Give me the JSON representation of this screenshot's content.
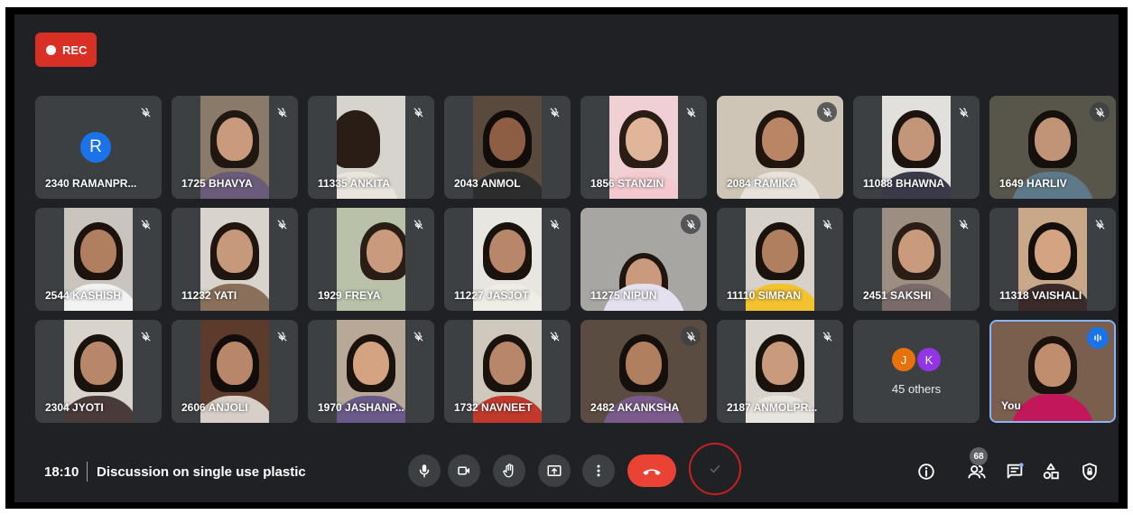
{
  "rec": {
    "label": "REC"
  },
  "participants": [
    {
      "name": "2340 RAMANPR...",
      "initial": "R"
    },
    {
      "name": "1725 BHAVYA"
    },
    {
      "name": "11335 ANKITA"
    },
    {
      "name": "2043 ANMOL"
    },
    {
      "name": "1856 STANZIN"
    },
    {
      "name": "2084 RAMIKA"
    },
    {
      "name": "11088 BHAWNA"
    },
    {
      "name": "1649 HARLIV"
    },
    {
      "name": "2544 KASHISH"
    },
    {
      "name": "11232 YATI"
    },
    {
      "name": "1929 FREYA"
    },
    {
      "name": "11227 JASJOT"
    },
    {
      "name": "11275 NIPUN"
    },
    {
      "name": "11110 SIMRAN"
    },
    {
      "name": "2451 SAKSHI"
    },
    {
      "name": "11318 VAISHALI"
    },
    {
      "name": "2304 JYOTI"
    },
    {
      "name": "2606 ANJOLI"
    },
    {
      "name": "1970 JASHANP..."
    },
    {
      "name": "1732 NAVNEET"
    },
    {
      "name": "2482 AKANKSHA"
    },
    {
      "name": "2187 ANMOLPR..."
    }
  ],
  "others": {
    "initials": [
      "J",
      "K"
    ],
    "colors": [
      "#e8710a",
      "#9334e6"
    ],
    "label": "45 others"
  },
  "self": {
    "name": "You"
  },
  "footer": {
    "time": "18:10",
    "meeting_name": "Discussion on single use plastic",
    "people_count": "68"
  },
  "colors": {
    "background": "#202124",
    "tile": "#3c4043",
    "rec": "#d93025",
    "end_call": "#ea4335",
    "accent": "#1a73e8",
    "annotation": "#c5221f"
  }
}
